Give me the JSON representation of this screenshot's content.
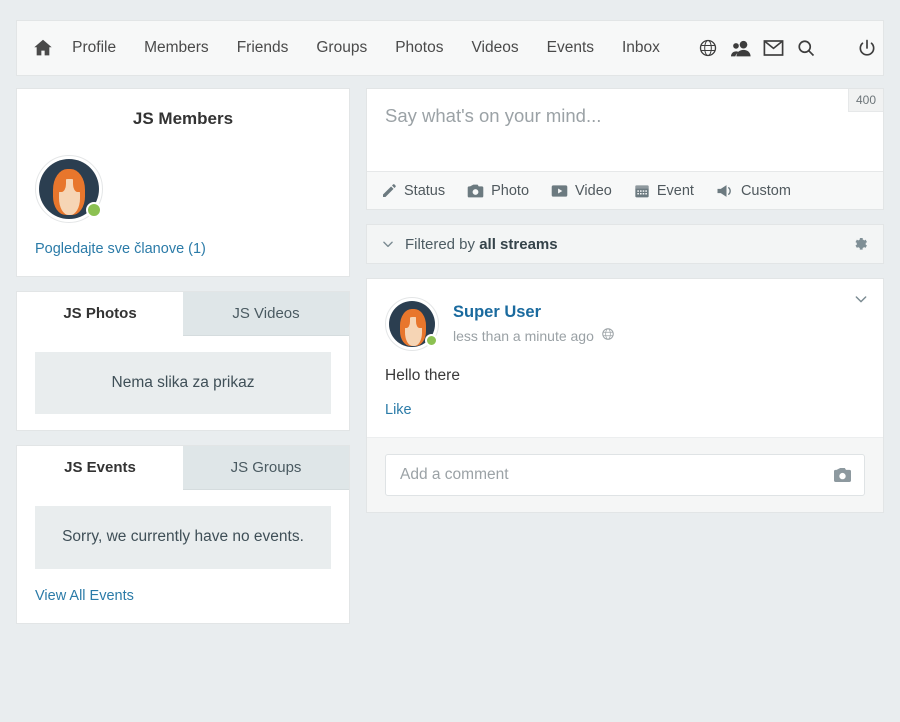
{
  "navbar": {
    "home_icon": "home-icon",
    "links": [
      {
        "label": "Profile"
      },
      {
        "label": "Members"
      },
      {
        "label": "Friends"
      },
      {
        "label": "Groups"
      },
      {
        "label": "Photos"
      },
      {
        "label": "Videos"
      },
      {
        "label": "Events"
      },
      {
        "label": "Inbox"
      }
    ],
    "icons": [
      {
        "name": "globe-icon"
      },
      {
        "name": "friends-icon"
      },
      {
        "name": "envelope-icon"
      },
      {
        "name": "search-icon"
      },
      {
        "name": "power-icon"
      }
    ]
  },
  "sidebar": {
    "members": {
      "title": "JS Members",
      "view_all_label": "Pogledajte sve članove (1)",
      "avatar_status": "online"
    },
    "photos": {
      "tabs": [
        {
          "label": "JS Photos",
          "active": true
        },
        {
          "label": "JS Videos",
          "active": false
        }
      ],
      "empty_text": "Nema slika za prikaz"
    },
    "events": {
      "tabs": [
        {
          "label": "JS Events",
          "active": true
        },
        {
          "label": "JS Groups",
          "active": false
        }
      ],
      "empty_text": "Sorry, we currently have no events.",
      "view_all_label": "View All Events"
    }
  },
  "composer": {
    "placeholder": "Say what's on your mind...",
    "char_count": "400",
    "items": [
      {
        "label": "Status",
        "icon": "pencil-icon"
      },
      {
        "label": "Photo",
        "icon": "camera-icon"
      },
      {
        "label": "Video",
        "icon": "video-icon"
      },
      {
        "label": "Event",
        "icon": "calendar-icon"
      },
      {
        "label": "Custom",
        "icon": "megaphone-icon"
      }
    ]
  },
  "filter": {
    "prefix": "Filtered by",
    "value": "all streams",
    "chevron_icon": "chevron-down-icon",
    "gear_icon": "gear-icon"
  },
  "post": {
    "author": "Super User",
    "time": "less than a minute ago",
    "privacy_icon": "globe-icon",
    "body": "Hello there",
    "like_label": "Like",
    "caret_icon": "chevron-down-icon",
    "comment_placeholder": "Add a comment",
    "comment_camera_icon": "camera-icon"
  },
  "colors": {
    "page_bg": "#e9edef",
    "panel_bg": "#ffffff",
    "border": "#e2e5e6",
    "link": "#2b7ba8",
    "author_link": "#1a6a9e",
    "avatar_bg": "#2b3e50",
    "avatar_hair": "#e8762c",
    "avatar_skin": "#f6d5b5",
    "online_dot": "#8cc152",
    "tab_inactive_bg": "#dfe6e8",
    "empty_box_bg": "#e9edee"
  }
}
